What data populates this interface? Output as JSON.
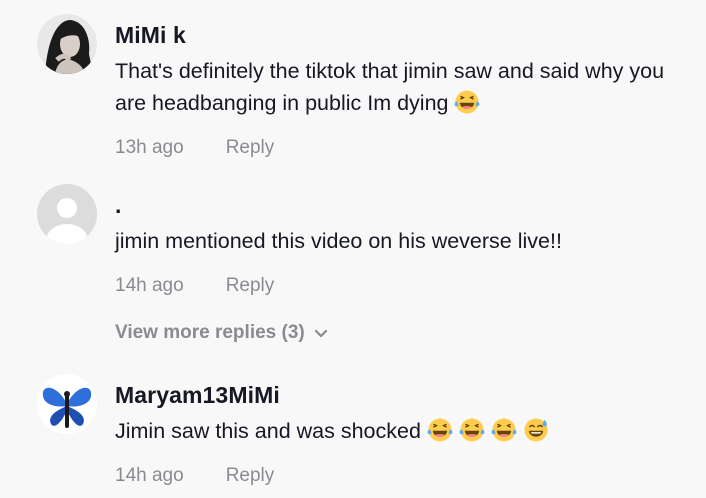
{
  "comments": [
    {
      "username": "MiMi k",
      "text": "That's definitely the tiktok that jimin saw and said why you are headbanging in public Im dying",
      "time": "13h ago",
      "reply_label": "Reply",
      "emojis": [
        "laughing-tears"
      ]
    },
    {
      "username": ".",
      "text": "jimin mentioned this video on his weverse live!!",
      "time": "14h ago",
      "reply_label": "Reply",
      "emojis": []
    },
    {
      "username": "Maryam13MiMi",
      "text": "Jimin saw this and was shocked",
      "time": "14h ago",
      "reply_label": "Reply",
      "emojis": [
        "laughing-tears",
        "laughing-tears",
        "laughing-tears",
        "sweat-smile"
      ]
    }
  ],
  "view_more_replies": "View more replies (3)",
  "colors": {
    "background": "#f8f8f8",
    "username": "#161823",
    "meta": "#8a8b91",
    "emoji_face": "#ffcc4d",
    "emoji_tear": "#5dadec"
  }
}
